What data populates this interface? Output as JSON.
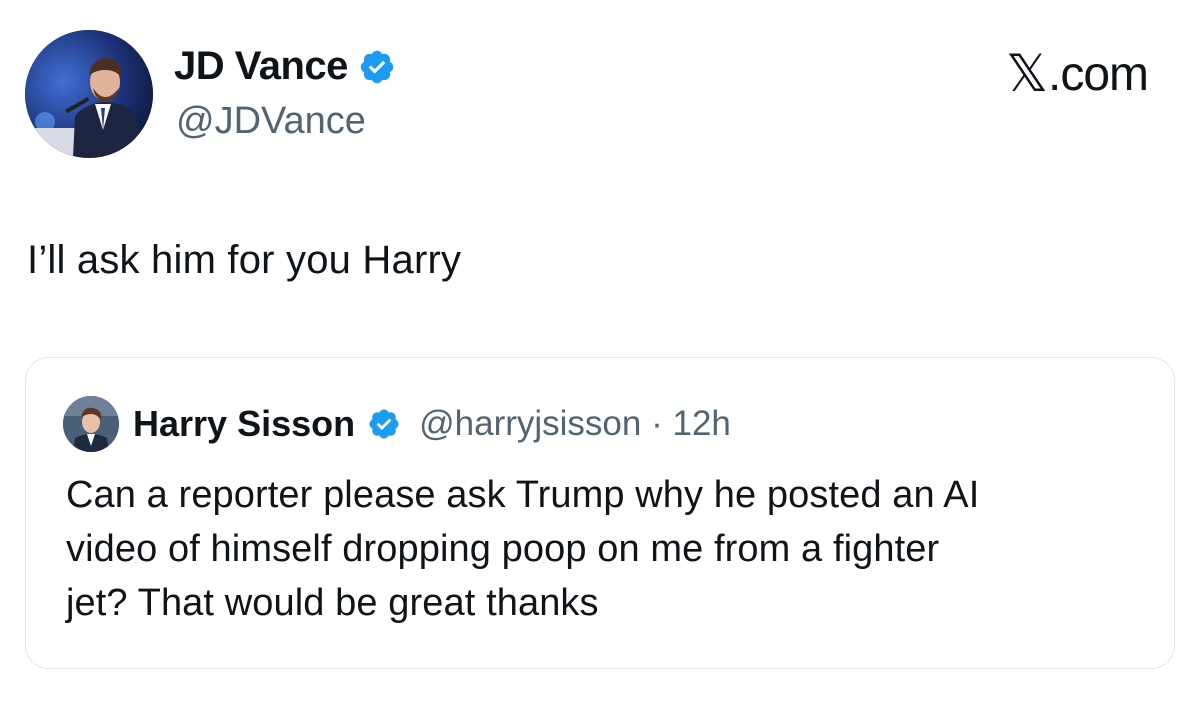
{
  "author": {
    "name": "JD Vance",
    "handle": "@JDVance",
    "avatar_icon": "profile-photo",
    "verified_icon": "verified-badge-icon"
  },
  "brand": {
    "label": ".com",
    "logo_glyph": "𝕏"
  },
  "tweet": {
    "text": "I’ll ask him for you Harry"
  },
  "quoted": {
    "name": "Harry Sisson",
    "handle": "@harryjsisson",
    "separator": " · ",
    "time": "12h",
    "lines": [
      "Can a reporter please ask Trump why he posted an AI",
      "video of himself dropping poop on me from a fighter",
      "jet? That would be great thanks"
    ]
  },
  "colors": {
    "text": "#0f1419",
    "secondary": "#536471",
    "verified": "#1d9bf0",
    "card_border": "#e1e8ed"
  }
}
